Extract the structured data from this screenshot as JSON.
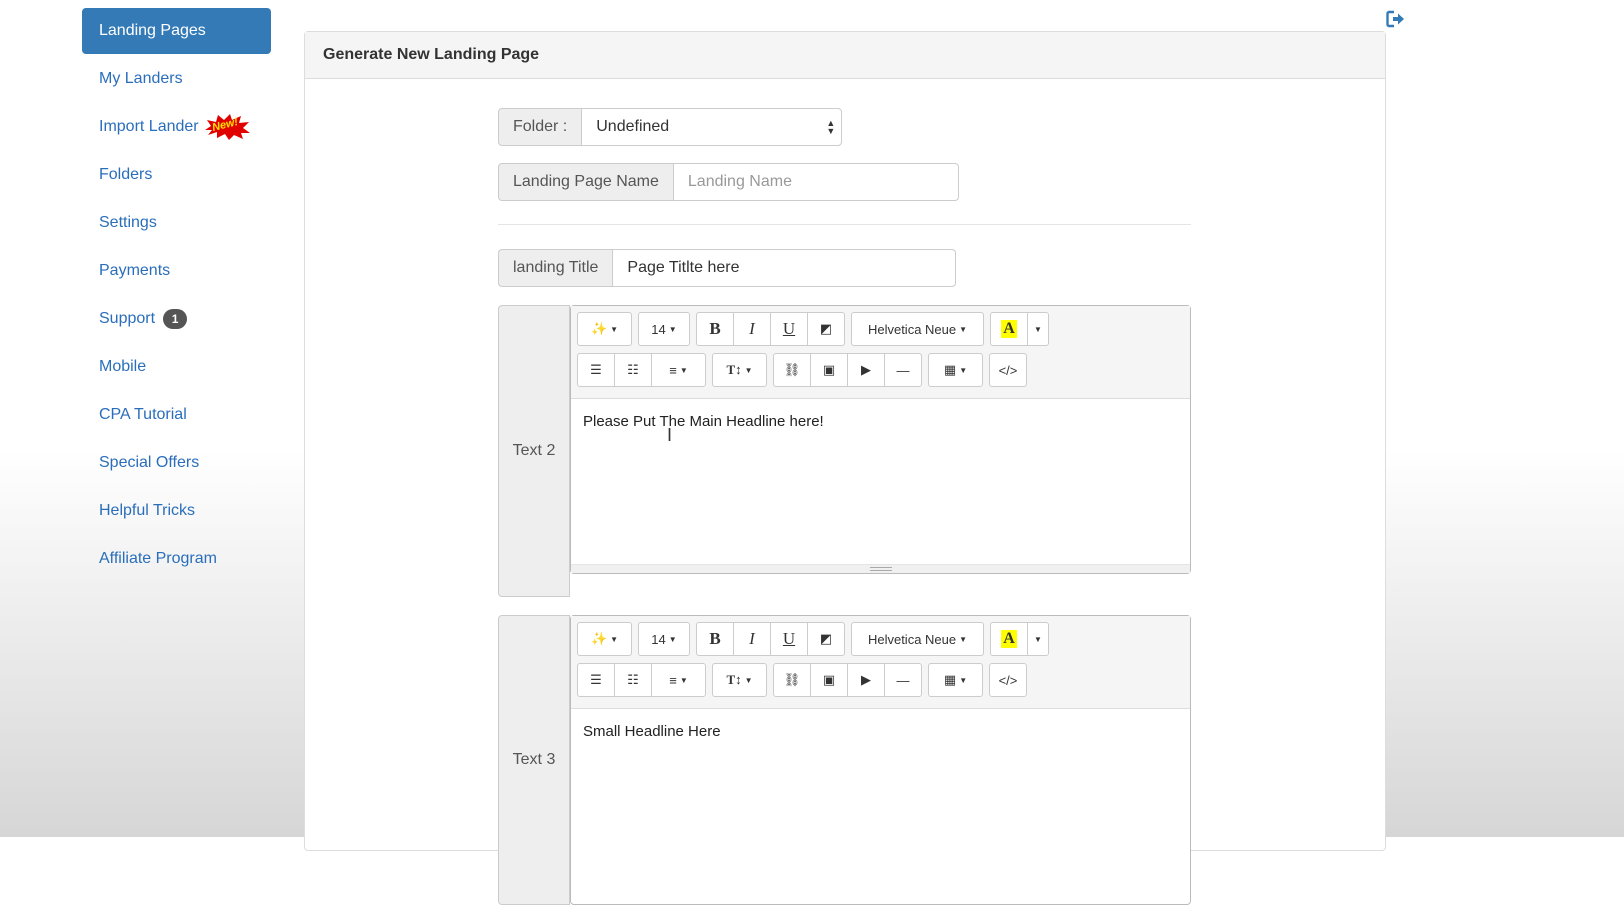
{
  "sidebar": {
    "items": [
      {
        "label": "Landing Pages",
        "active": true
      },
      {
        "label": "My Landers"
      },
      {
        "label": "Import Lander",
        "badge_new": "New!"
      },
      {
        "label": "Folders"
      },
      {
        "label": "Settings"
      },
      {
        "label": "Payments"
      },
      {
        "label": "Support",
        "count": "1"
      },
      {
        "label": "Mobile"
      },
      {
        "label": "CPA Tutorial"
      },
      {
        "label": "Special Offers"
      },
      {
        "label": "Helpful Tricks"
      },
      {
        "label": "Affiliate Program"
      }
    ]
  },
  "header": {
    "logout_icon": "logout-icon"
  },
  "panel": {
    "title": "Generate New Landing Page",
    "folder": {
      "label": "Folder :",
      "value": "Undefined"
    },
    "landing_name": {
      "label": "Landing Page Name",
      "placeholder": "Landing Name"
    },
    "landing_title": {
      "label": "landing Title",
      "value": "Page Titlte here"
    },
    "editors": [
      {
        "label": "Text 2",
        "content": "Please Put The Main Headline here!"
      },
      {
        "label": "Text 3",
        "content": "Small Headline Here"
      }
    ],
    "toolbar": {
      "font_size": "14",
      "font_name": "Helvetica Neue",
      "bold": "B",
      "italic": "I",
      "underline": "U",
      "color_letter": "A",
      "height_label": "T↕",
      "code": "</>"
    }
  },
  "colors": {
    "primary": "#337ab7",
    "link": "#2a6ebb",
    "highlight": "#ffff00"
  }
}
